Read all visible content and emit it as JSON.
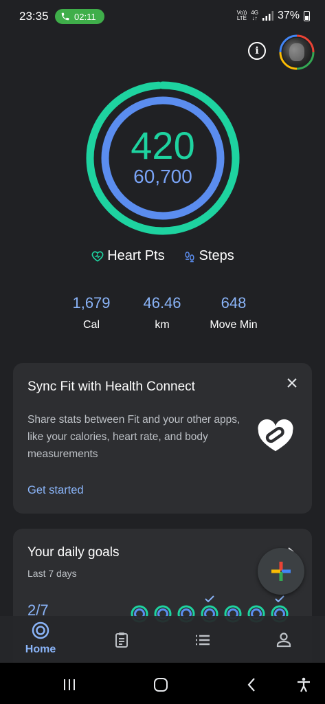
{
  "status_bar": {
    "time": "23:35",
    "call_duration": "02:11",
    "volte_line1": "Vo))",
    "volte_line2": "LTE",
    "network": "4G",
    "battery": "37%"
  },
  "header": {
    "info_icon": "info-icon",
    "avatar_icon": "profile-avatar"
  },
  "rings": {
    "heart_points": "420",
    "steps": "60,700",
    "heart_color": "#1ed3a0",
    "steps_color": "#5b8def",
    "heart_progress": 0.99,
    "steps_progress": 1.0
  },
  "legend": {
    "heart_label": "Heart Pts",
    "steps_label": "Steps"
  },
  "stats": [
    {
      "value": "1,679",
      "label": "Cal"
    },
    {
      "value": "46.46",
      "label": "km"
    },
    {
      "value": "648",
      "label": "Move Min"
    }
  ],
  "sync_card": {
    "title": "Sync Fit with Health Connect",
    "body": "Share stats between Fit and your other apps, like your calories, heart rate, and body measurements",
    "action": "Get started"
  },
  "goals_card": {
    "title": "Your daily goals",
    "subtitle": "Last 7 days",
    "fraction": "2/7"
  },
  "bottom_nav": {
    "home_label": "Home"
  },
  "colors": {
    "accent": "#8ab4f8",
    "background": "#202124",
    "card": "#2d2e31"
  }
}
